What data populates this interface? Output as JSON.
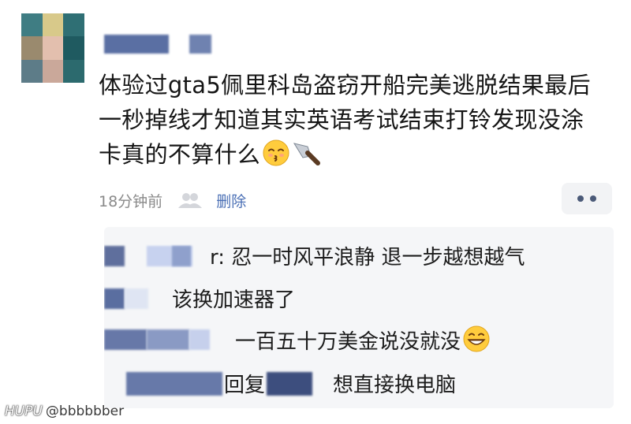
{
  "post": {
    "text": "体验过gta5佩里科岛盗窃开船完美逃脱结果最后一秒掉线才知道其实英语考试结束打铃发现没涂卡真的不算什么",
    "emoji_icons": [
      "kissing-face-icon",
      "kitchen-knife-icon"
    ]
  },
  "meta": {
    "time": "18分钟前",
    "delete_label": "删除"
  },
  "replies": [
    {
      "text": "r: 忍一时风平浪静 退一步越想越气"
    },
    {
      "text": "该换加速器了"
    },
    {
      "text": "一百五十万美金说没就没",
      "emoji_icon": "grinning-face-icon"
    },
    {
      "prefix": "回复",
      "text": "想直接换电脑"
    }
  ],
  "watermark": {
    "brand": "HUPU",
    "handle": "@bbbbbber"
  }
}
